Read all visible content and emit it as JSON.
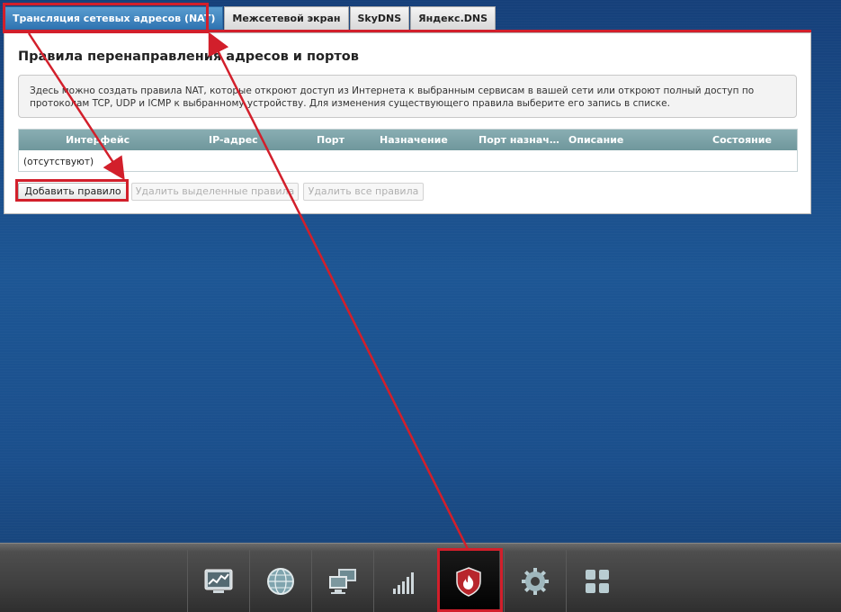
{
  "tabs": [
    {
      "label": "Трансляция сетевых адресов (NAT)",
      "active": true
    },
    {
      "label": "Межсетевой экран",
      "active": false
    },
    {
      "label": "SkyDNS",
      "active": false
    },
    {
      "label": "Яндекс.DNS",
      "active": false
    }
  ],
  "panel": {
    "title": "Правила перенаправления адресов и портов",
    "info_line1": "Здесь можно создать правила NAT, которые откроют доступ из Интернета к выбранным сервисам в вашей сети или откроют полный доступ по",
    "info_line2": "протоколам TCP, UDP и ICMP к выбранному устройству. Для изменения существующего правила выберите его запись в списке."
  },
  "table": {
    "columns": [
      "Интерфейс",
      "IP-адрес",
      "Порт",
      "Назначение",
      "Порт назнач…",
      "Описание",
      "Состояние"
    ],
    "empty_text": "(отсутствуют)"
  },
  "buttons": {
    "add": "Добавить правило",
    "delete_selected": "Удалить выделенные правила",
    "delete_all": "Удалить все правила"
  },
  "bottom_nav": [
    {
      "icon": "chart-monitor-icon"
    },
    {
      "icon": "globe-icon"
    },
    {
      "icon": "network-computers-icon"
    },
    {
      "icon": "signal-bars-icon"
    },
    {
      "icon": "firewall-shield-icon",
      "active": true
    },
    {
      "icon": "gear-icon"
    },
    {
      "icon": "apps-grid-icon"
    }
  ],
  "colors": {
    "accent_red": "#d21f2b",
    "tab_active": "#2f74b2",
    "table_header": "#7ea2a6"
  }
}
